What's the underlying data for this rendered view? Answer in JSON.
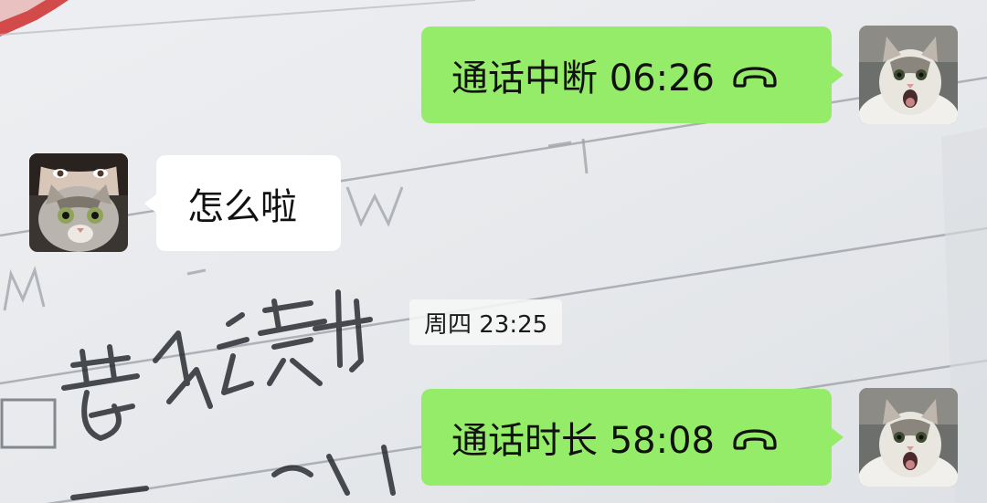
{
  "chat": {
    "messages": [
      {
        "sender": "self",
        "text": "通话中断 06:26",
        "icon": "phone-hangup-icon"
      },
      {
        "sender": "other",
        "text": "怎么啦"
      },
      {
        "sender": "self",
        "text": "通话时长 58:08",
        "icon": "phone-hangup-icon"
      }
    ],
    "timestamp": "周四 23:25"
  },
  "colors": {
    "self_bubble": "#95ec69",
    "other_bubble": "#ffffff"
  }
}
